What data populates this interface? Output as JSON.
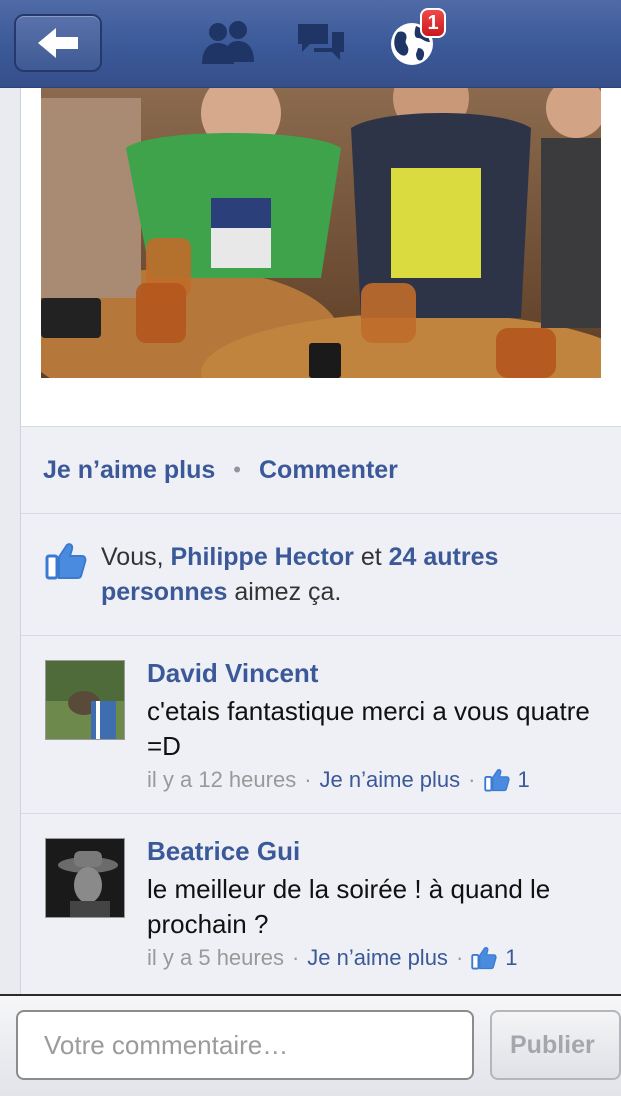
{
  "nav": {
    "back_icon": "arrow-left-icon",
    "friends_icon": "friends-icon",
    "messages_icon": "messages-icon",
    "notifications_icon": "globe-icon",
    "notifications_count": "1",
    "brand_color": "#3b5998"
  },
  "story": {
    "photo_alt": "group-photo",
    "actions": {
      "unlike_label": "Je n’aime plus",
      "separator": "•",
      "comment_label": "Commenter"
    },
    "likes": {
      "prefix": "Vous, ",
      "friend": "Philippe Hector",
      "middle": " et ",
      "others": "24 autres personnes",
      "suffix": " aimez ça."
    },
    "comments": [
      {
        "author": "David Vincent",
        "text": "c'etais fantastique merci a vous quatre =D",
        "time": "il y a 12 heures",
        "unlike_label": "Je n’aime plus",
        "like_count": "1"
      },
      {
        "author": "Beatrice Gui",
        "text": "le meilleur de la soirée ! à quand le prochain ?",
        "time": "il y a 5 heures",
        "unlike_label": "Je n’aime plus",
        "like_count": "1"
      }
    ]
  },
  "composer": {
    "placeholder": "Votre commentaire…",
    "publish_label": "Publier"
  }
}
